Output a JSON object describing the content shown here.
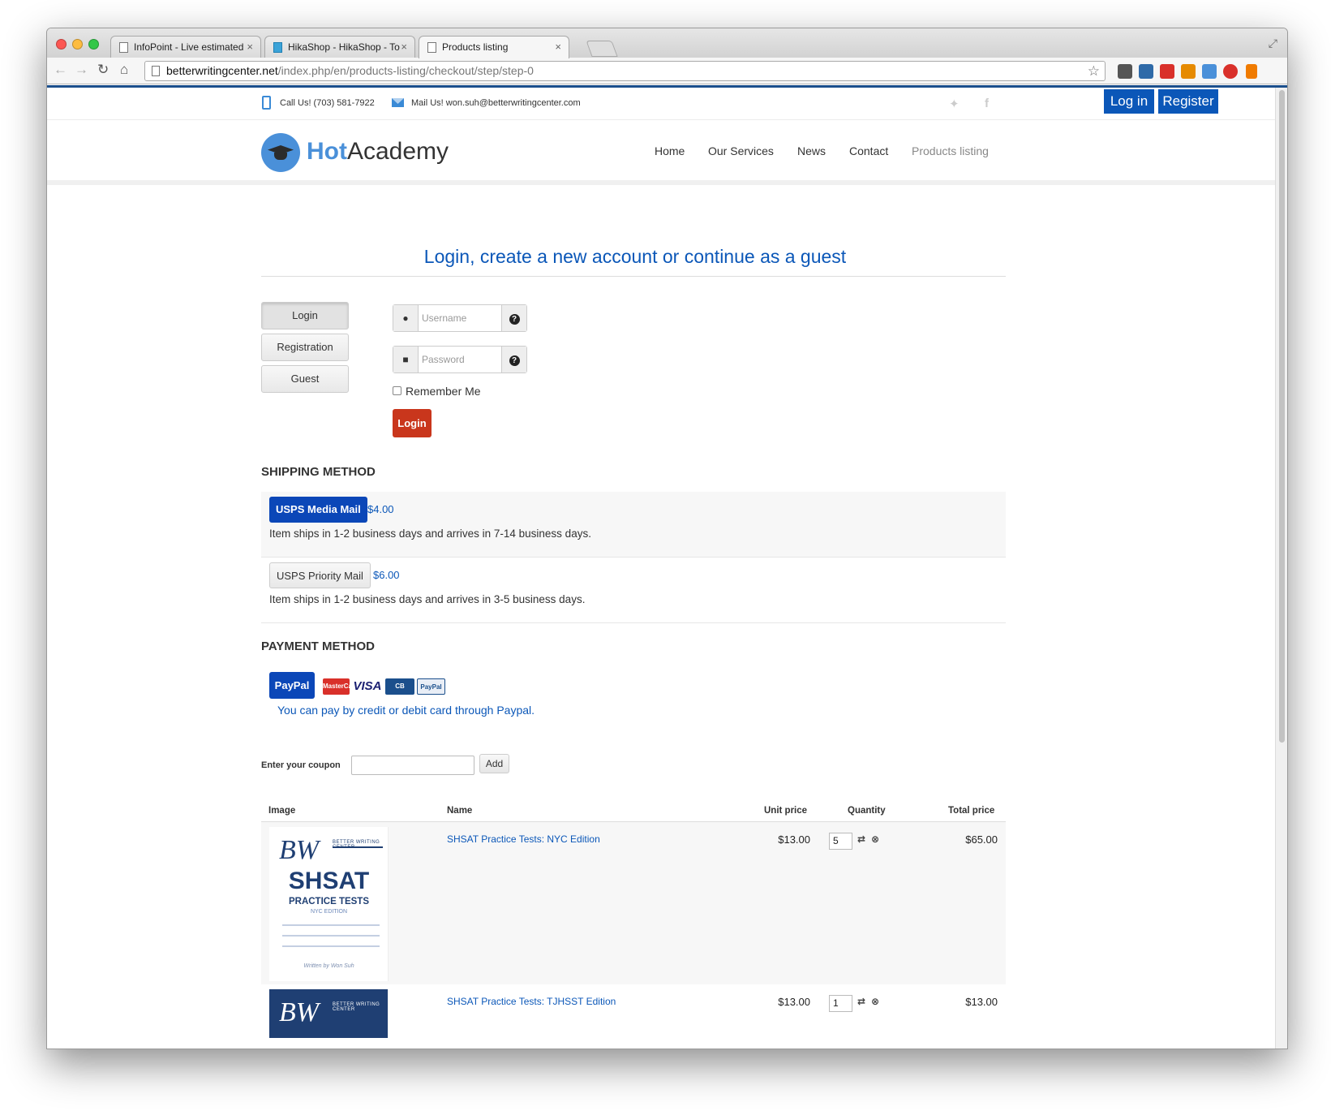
{
  "browser": {
    "tabs": [
      {
        "title": "InfoPoint - Live estimated"
      },
      {
        "title": "HikaShop - HikaShop - To"
      },
      {
        "title": "Products listing"
      }
    ],
    "url_host": "betterwritingcenter.net",
    "url_path": "/index.php/en/products-listing/checkout/step/step-0"
  },
  "topbar": {
    "call": "Call Us! (703) 581-7922",
    "mail": "Mail Us! won.suh@betterwritingcenter.com",
    "login": "Log in",
    "register": "Register"
  },
  "header": {
    "logo_hot": "Hot",
    "logo_academy": "Academy",
    "nav": [
      "Home",
      "Our Services",
      "News",
      "Contact",
      "Products listing"
    ]
  },
  "checkout": {
    "heading": "Login, create a new account or continue as a guest",
    "tabs": [
      "Login",
      "Registration",
      "Guest"
    ],
    "username_placeholder": "Username",
    "password_placeholder": "Password",
    "remember": "Remember Me",
    "login_button": "Login"
  },
  "shipping": {
    "title": "SHIPPING METHOD",
    "methods": [
      {
        "name": "USPS Media Mail",
        "price": "$4.00",
        "desc": "Item ships in 1-2 business days and arrives in 7-14 business days."
      },
      {
        "name": "USPS Priority Mail",
        "price": "$6.00",
        "desc": "Item ships in 1-2 business days and arrives in 3-5 business days."
      }
    ]
  },
  "payment": {
    "title": "PAYMENT METHOD",
    "method": "PayPal",
    "cards": [
      "MasterCard",
      "VISA",
      "CB",
      "PayPal"
    ],
    "desc": "You can pay by credit or debit card through Paypal."
  },
  "coupon": {
    "label": "Enter your coupon",
    "button": "Add"
  },
  "cart": {
    "headers": [
      "Image",
      "Name",
      "Unit price",
      "Quantity",
      "Total price"
    ],
    "rows": [
      {
        "name": "SHSAT Practice Tests: NYC Edition",
        "unit": "$13.00",
        "qty": "5",
        "total": "$65.00"
      },
      {
        "name": "SHSAT Practice Tests: TJHSST Edition",
        "unit": "$13.00",
        "qty": "1",
        "total": "$13.00"
      }
    ],
    "book": {
      "brand": "BETTER WRITING CENTER",
      "title": "SHSAT",
      "subtitle": "PRACTICE TESTS",
      "edition": "NYC EDITION",
      "author": "Written by Won Suh"
    }
  }
}
